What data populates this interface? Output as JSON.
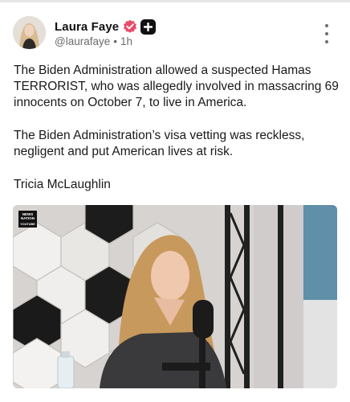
{
  "author": {
    "display_name": "Laura Faye",
    "handle": "@laurafaye",
    "separator": "•",
    "timestamp": "1h",
    "verified_icon": "verified-badge-icon",
    "plus_icon": "plus-badge-icon"
  },
  "post": {
    "paragraphs": [
      "The Biden Administration allowed a suspected Hamas TERRORIST, who was allegedly involved in massacring 69 innocents on October 7, to live in America.",
      "The Biden Administration’s visa vetting was reckless, negligent and put American lives at risk.",
      "Tricia McLaughlin"
    ]
  },
  "media": {
    "channel_logo_text": "NEWS NATION",
    "channel_sub_label": "YOUTUBE"
  },
  "colors": {
    "verified": "#e84c6a",
    "text": "#1a1a1a",
    "muted": "#6b6b6b"
  }
}
